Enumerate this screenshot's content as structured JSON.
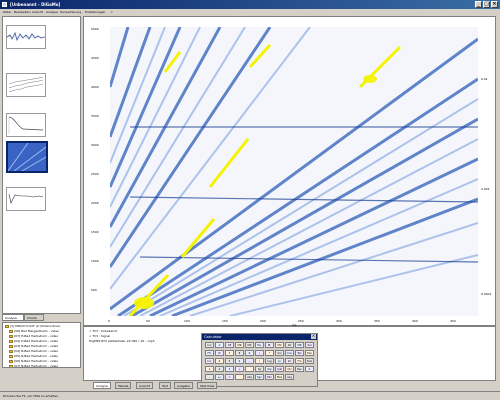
{
  "window": {
    "title": "[Unbenannt - DiGaMo]",
    "controls": [
      "_",
      "□",
      "×"
    ]
  },
  "menu": [
    "Datei",
    "Bearbeiten",
    "Ansicht",
    "Analyse",
    "Konvertierung",
    "Einstellungen",
    "?"
  ],
  "left_tabs": [
    "Analyse",
    "Charts"
  ],
  "tree": {
    "items": [
      "[1] MID/074 OdT (C:\\Unterordner)",
      "[06] Bad Mergentheim - video",
      "[07] H-Bad Herbstrom - video",
      "[02] H-Bad Herbstrom - video",
      "[03] N-Bad Herbstrom - video",
      "[04] N-Bad Herbstrom - video",
      "[05] N-Bad Herbstrom - video",
      "[06] N-Bad Herbstrom - video",
      "[07] N-Bad Herbstrom - video"
    ]
  },
  "plot": {
    "y_ticks": [
      "5000",
      "4500",
      "4000",
      "3500",
      "3000",
      "2500",
      "2000",
      "1500",
      "1000",
      "500"
    ],
    "x_ticks": [
      "0",
      "50",
      "100",
      "150",
      "200",
      "250",
      "300",
      "350",
      "400",
      "450"
    ],
    "x_label": "ms",
    "right_ticks": [
      "0.01",
      "0.001",
      "0.0001"
    ]
  },
  "console": {
    "lines": [
      "> Tr/3 : Unbekannt",
      "> Tr/3 : Signal",
      "  DigMP2 RT4 (Abtastrate: 22 050 / 16 ...mp3"
    ]
  },
  "calculator": {
    "title": "Calculator",
    "keys": [
      "Inv",
      "C",
      "CE",
      "MR",
      "MS",
      "M+",
      "M-",
      "MC",
      "Alt",
      "MR",
      "Sel",
      "Ftc",
      "Pi",
      "7",
      "8",
      "9",
      "/",
      "*",
      "Sin",
      "Cos",
      "Tan",
      "Exp",
      "Inv",
      "4",
      "5",
      "6",
      "-",
      "/",
      "Log",
      "Ln",
      "Int",
      "Fra",
      "Pow",
      "1",
      "2",
      "3",
      "+",
      "",
      "Sq",
      "Sqr",
      "Cub",
      "Cbr",
      "Rec",
      "0",
      ",",
      "+/-",
      "=",
      "",
      "Abs",
      "Sgn",
      "Min",
      "Max",
      "Avg"
    ]
  },
  "bottom_tabs": [
    "Analyse",
    "Tabelle",
    "Ansicht",
    "Text",
    "Ausgabe",
    "Stat.View"
  ],
  "status": "Drücken Sie F1, um Hilfe zu erhalten.",
  "colors": {
    "plot_background": "#ffffff",
    "plot_stripe": "#2f5fb8",
    "plot_peak": "#f4f400",
    "titlebar": "#0a246a"
  }
}
